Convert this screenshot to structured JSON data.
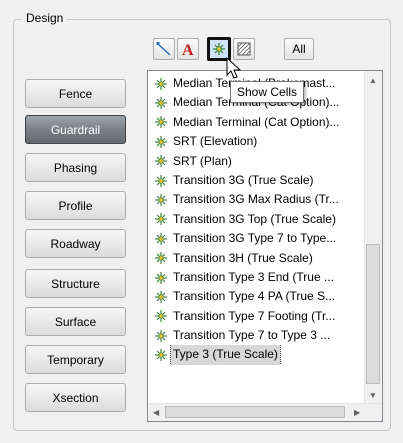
{
  "group": {
    "title": "Design"
  },
  "toolbar": {
    "icons": [
      "line-icon",
      "text-icon",
      "cell-icon",
      "pattern-icon"
    ],
    "all_label": "All",
    "tooltip": "Show Cells"
  },
  "categories": [
    "Fence",
    "Guardrail",
    "Phasing",
    "Profile",
    "Roadway",
    "Structure",
    "Surface",
    "Temporary",
    "Xsection"
  ],
  "selected_category": "Guardrail",
  "list": {
    "items": [
      "Median Terminal (Brakemast...",
      "Median Terminal (Cat Option)...",
      "Median Terminal (Cat Option)...",
      "SRT (Elevation)",
      "SRT (Plan)",
      "Transition 3G (True Scale)",
      "Transition 3G Max Radius (Tr...",
      "Transition 3G Top (True Scale)",
      "Transition 3G Type 7 to Type...",
      "Transition 3H (True Scale)",
      "Transition Type 3 End (True ...",
      "Transition Type 4 PA (True S...",
      "Transition Type 7 Footing (Tr...",
      "Transition Type 7 to Type 3 ...",
      "Type 3 (True Scale)"
    ],
    "selected_item": "Type 3 (True Scale)"
  }
}
